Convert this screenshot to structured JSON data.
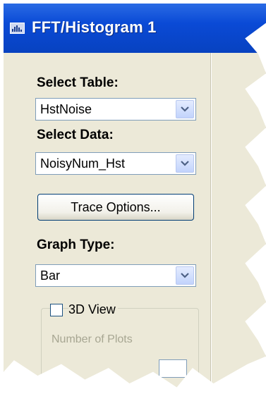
{
  "window": {
    "title": "FFT/Histogram 1",
    "icon": "chart-window-icon"
  },
  "select_table": {
    "label": "Select Table:",
    "value": "HstNoise"
  },
  "select_data": {
    "label": "Select Data:",
    "value": "NoisyNum_Hst"
  },
  "trace_options_button": "Trace Options...",
  "graph_type": {
    "label": "Graph Type:",
    "value": "Bar"
  },
  "view_3d": {
    "label": "3D View",
    "checked": false
  },
  "number_of_plots_label": "Number of Plots",
  "colors": {
    "titlebar": "#0a4ad6",
    "panel": "#ece9d8",
    "combo_border": "#7f9db9"
  }
}
